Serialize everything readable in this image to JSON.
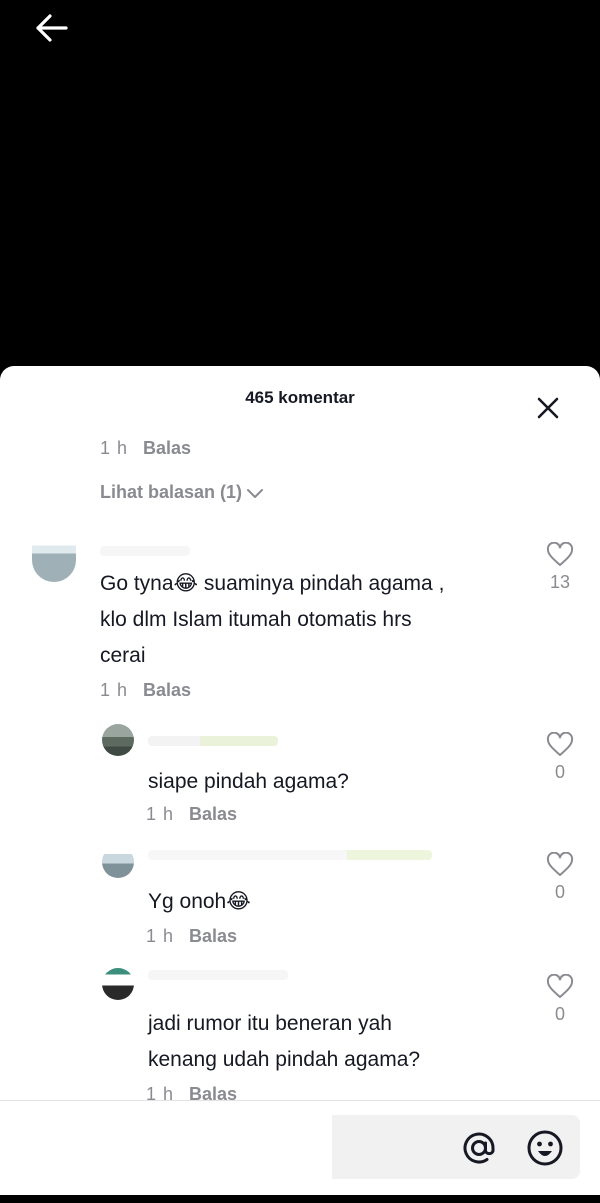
{
  "header": {
    "title": "465 komentar"
  },
  "previous_comment": {
    "time": "1 h",
    "reply_label": "Balas",
    "view_replies": "Lihat balasan (1)"
  },
  "main_comment": {
    "text_line1": "Go tyna😂 suaminya pindah agama ,",
    "text_line2": "klo dlm Islam itumah otomatis hrs",
    "text_line3": "cerai",
    "time": "1 h",
    "reply_label": "Balas",
    "likes": "13"
  },
  "replies": [
    {
      "text": "siape pindah agama?",
      "time": "1 h",
      "reply_label": "Balas",
      "likes": "0"
    },
    {
      "text": "Yg onoh😂",
      "time": "1 h",
      "reply_label": "Balas",
      "likes": "0"
    },
    {
      "text_line1": "jadi rumor itu beneran yah",
      "text_line2": "kenang udah pindah agama?",
      "time": "1 h",
      "reply_label": "Balas",
      "likes": "0"
    }
  ],
  "composer": {
    "placeholder": ""
  },
  "icons": {
    "back": "arrow-left-icon",
    "close": "close-icon",
    "like": "heart-outline-icon",
    "mention": "at-sign-icon",
    "emoji": "emoji-icon",
    "chevron": "chevron-down-icon"
  },
  "colors": {
    "text": "#161823",
    "muted": "#8a8b91",
    "background": "#ffffff",
    "video_area": "#000000"
  }
}
